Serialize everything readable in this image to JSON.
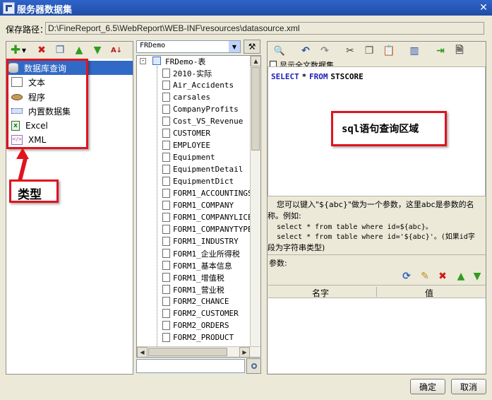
{
  "window": {
    "title": "服务器数据集"
  },
  "save_path": {
    "label": "保存路径：",
    "value": "D:\\FineReport_6.5\\WebReport\\WEB-INF\\resources\\datasource.xml"
  },
  "types": {
    "items": [
      {
        "label": "数据库查询",
        "icon": "database-icon",
        "selected": true
      },
      {
        "label": "文本",
        "icon": "text-file-icon"
      },
      {
        "label": "程序",
        "icon": "program-icon"
      },
      {
        "label": "内置数据集",
        "icon": "embedded-dataset-icon"
      },
      {
        "label": "Excel",
        "icon": "excel-icon"
      },
      {
        "label": "XML",
        "icon": "xml-icon"
      }
    ],
    "annotation": "类型"
  },
  "connection": {
    "selected": "FRDemo",
    "root": "FRDemo-表",
    "tables": [
      "2010-实际",
      "Air_Accidents",
      "carsales",
      "CompanyProfits",
      "Cost_VS_Revenue",
      "CUSTOMER",
      "EMPLOYEE",
      "Equipment",
      "EquipmentDetail",
      "EquipmentDict",
      "FORM1_ACCOUNTINGS",
      "FORM1_COMPANY",
      "FORM1_COMPANYLICEI",
      "FORM1_COMPANYTYPE",
      "FORM1_INDUSTRY",
      "FORM1_企业所得税",
      "FORM1_基本信息",
      "FORM1_增值税",
      "FORM1_营业税",
      "FORM2_CHANCE",
      "FORM2_CUSTOMER",
      "FORM2_ORDERS",
      "FORM2_PRODUCT"
    ]
  },
  "sql": {
    "kw_select": "SELECT",
    "star": "*",
    "kw_from": "FROM",
    "table": "STSCORE",
    "annotation": "sql语句查询区域",
    "checkbox_label": "显示全文数据集"
  },
  "hint": {
    "line1": "您可以键入\"${abc}\"做为一个参数，这里abc是参数的名",
    "line2": "称。例如:",
    "line3": "select * from table where id=${abc}。",
    "line4": "select * from table where id='${abc}'。(如果id字",
    "line5": "段为字符串类型)"
  },
  "params": {
    "label": "参数:",
    "col_name": "名字",
    "col_value": "值"
  },
  "buttons": {
    "ok": "确定",
    "cancel": "取消"
  }
}
